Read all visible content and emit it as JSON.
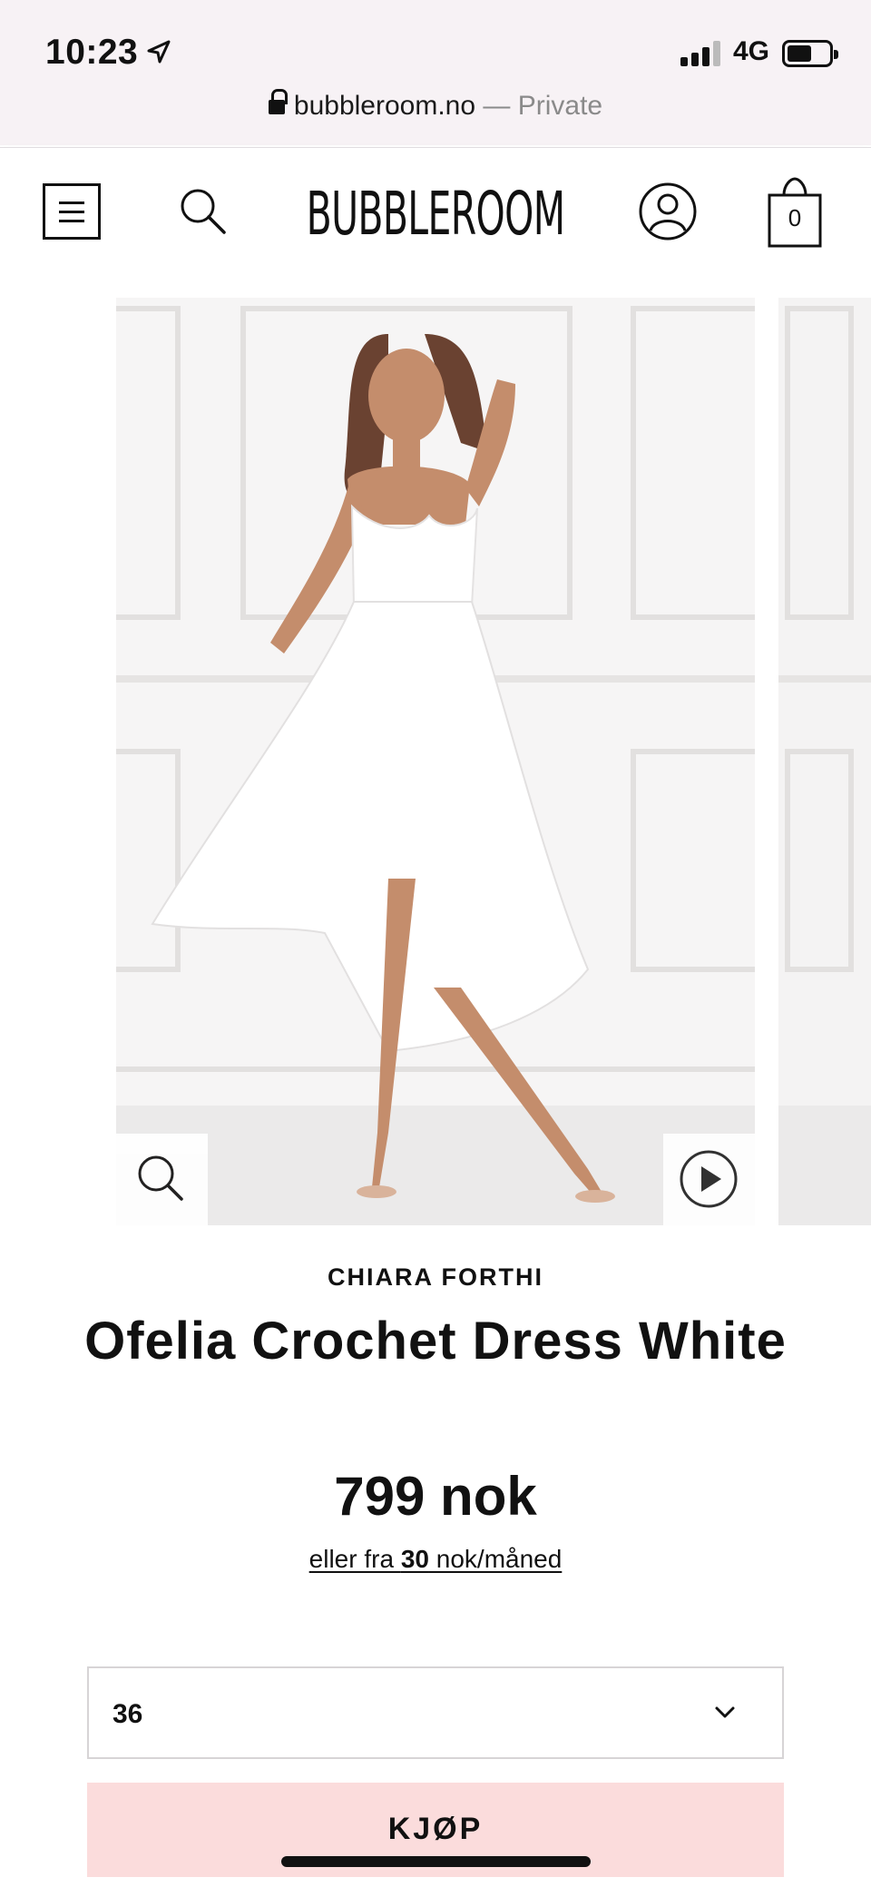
{
  "status_bar": {
    "time": "10:23",
    "network": "4G",
    "url_domain": "bubbleroom.no",
    "url_mode": "— Private"
  },
  "header": {
    "logo_text": "BUBBLEROOM",
    "cart_count": "0"
  },
  "icons": {
    "menu": "hamburger-menu-icon",
    "search": "search-icon",
    "account": "user-icon",
    "cart": "shopping-bag-icon",
    "zoom": "search-icon",
    "video": "play-icon",
    "dropdown": "chevron-down-icon"
  },
  "product": {
    "brand": "CHIARA FORTHI",
    "title": "Ofelia Crochet Dress White",
    "price": "799 nok",
    "installment_prefix": "eller fra ",
    "installment_amount": "30",
    "installment_suffix": " nok/måned"
  },
  "size_selector": {
    "selected": "36"
  },
  "buy_button": {
    "label": "KJØP"
  },
  "colors": {
    "status_bg": "#f7f2f5",
    "buy_button_bg": "#fbdcdc",
    "text": "#111111"
  }
}
